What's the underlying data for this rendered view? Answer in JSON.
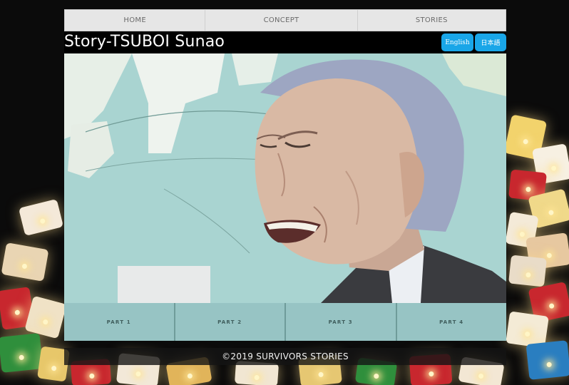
{
  "nav": {
    "items": [
      {
        "label": "HOME"
      },
      {
        "label": "CONCEPT"
      },
      {
        "label": "STORIES"
      }
    ]
  },
  "header": {
    "title": "Story-TSUBOI Sunao",
    "lang_en": "English",
    "lang_ja": "日本語"
  },
  "parts": [
    {
      "label": "PART 1"
    },
    {
      "label": "PART 2"
    },
    {
      "label": "PART 3"
    },
    {
      "label": "PART 4"
    }
  ],
  "footer": {
    "text": "©2019  SURVIVORS STORIES"
  },
  "colors": {
    "nav_bg": "#e6e6e6",
    "lang_button": "#19a6e8",
    "parts_bg": "#a0cdcd",
    "page_bg": "#0b0b0b"
  }
}
